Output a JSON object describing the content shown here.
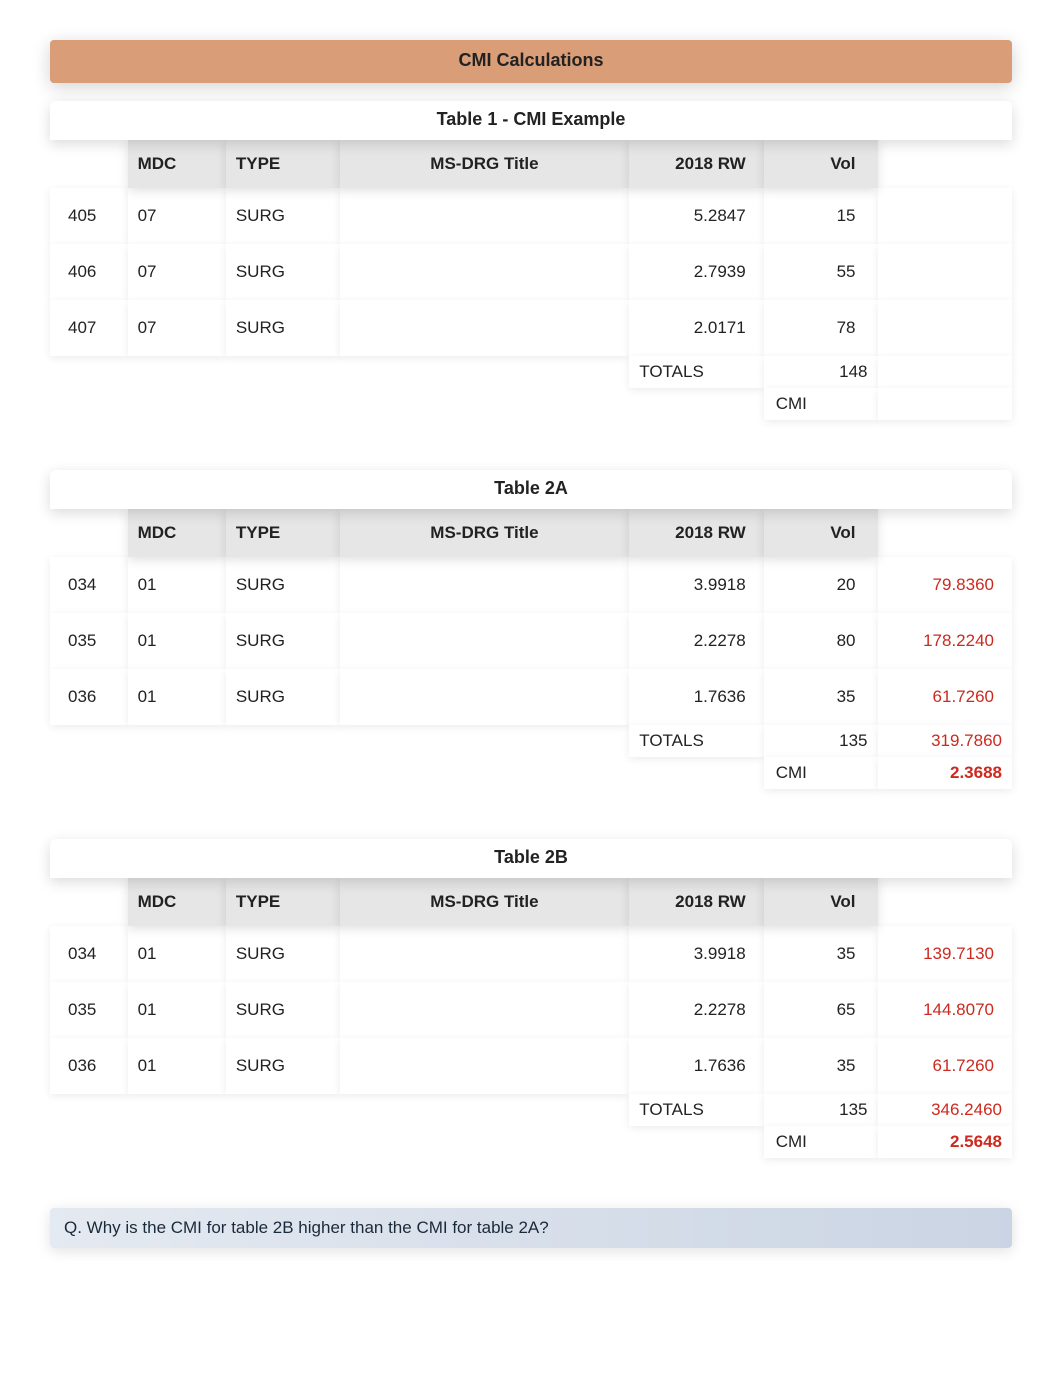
{
  "page_header": "CMI Calculations",
  "columns": {
    "mdc": "MDC",
    "type": "TYPE",
    "title": "MS-DRG Title",
    "rw": "2018 RW",
    "vol": "Vol"
  },
  "labels": {
    "totals": "TOTALS",
    "cmi": "CMI"
  },
  "table1": {
    "title": "Table 1 - CMI Example",
    "rows": [
      {
        "drg": "405",
        "mdc": "07",
        "type": "SURG",
        "title": "",
        "rw": "5.2847",
        "vol": "15",
        "calc": ""
      },
      {
        "drg": "406",
        "mdc": "07",
        "type": "SURG",
        "title": "",
        "rw": "2.7939",
        "vol": "55",
        "calc": ""
      },
      {
        "drg": "407",
        "mdc": "07",
        "type": "SURG",
        "title": "",
        "rw": "2.0171",
        "vol": "78",
        "calc": ""
      }
    ],
    "totals_vol": "148",
    "totals_calc": "",
    "cmi_val": ""
  },
  "table2a": {
    "title": "Table 2A",
    "rows": [
      {
        "drg": "034",
        "mdc": "01",
        "type": "SURG",
        "title": "",
        "rw": "3.9918",
        "vol": "20",
        "calc": "79.8360"
      },
      {
        "drg": "035",
        "mdc": "01",
        "type": "SURG",
        "title": "",
        "rw": "2.2278",
        "vol": "80",
        "calc": "178.2240"
      },
      {
        "drg": "036",
        "mdc": "01",
        "type": "SURG",
        "title": "",
        "rw": "1.7636",
        "vol": "35",
        "calc": "61.7260"
      }
    ],
    "totals_vol": "135",
    "totals_calc": "319.7860",
    "cmi_val": "2.3688"
  },
  "table2b": {
    "title": "Table 2B",
    "rows": [
      {
        "drg": "034",
        "mdc": "01",
        "type": "SURG",
        "title": "",
        "rw": "3.9918",
        "vol": "35",
        "calc": "139.7130"
      },
      {
        "drg": "035",
        "mdc": "01",
        "type": "SURG",
        "title": "",
        "rw": "2.2278",
        "vol": "65",
        "calc": "144.8070"
      },
      {
        "drg": "036",
        "mdc": "01",
        "type": "SURG",
        "title": "",
        "rw": "1.7636",
        "vol": "35",
        "calc": "61.7260"
      }
    ],
    "totals_vol": "135",
    "totals_calc": "346.2460",
    "cmi_val": "2.5648"
  },
  "question": "Q. Why is the CMI for table 2B higher than the CMI for table 2A?"
}
